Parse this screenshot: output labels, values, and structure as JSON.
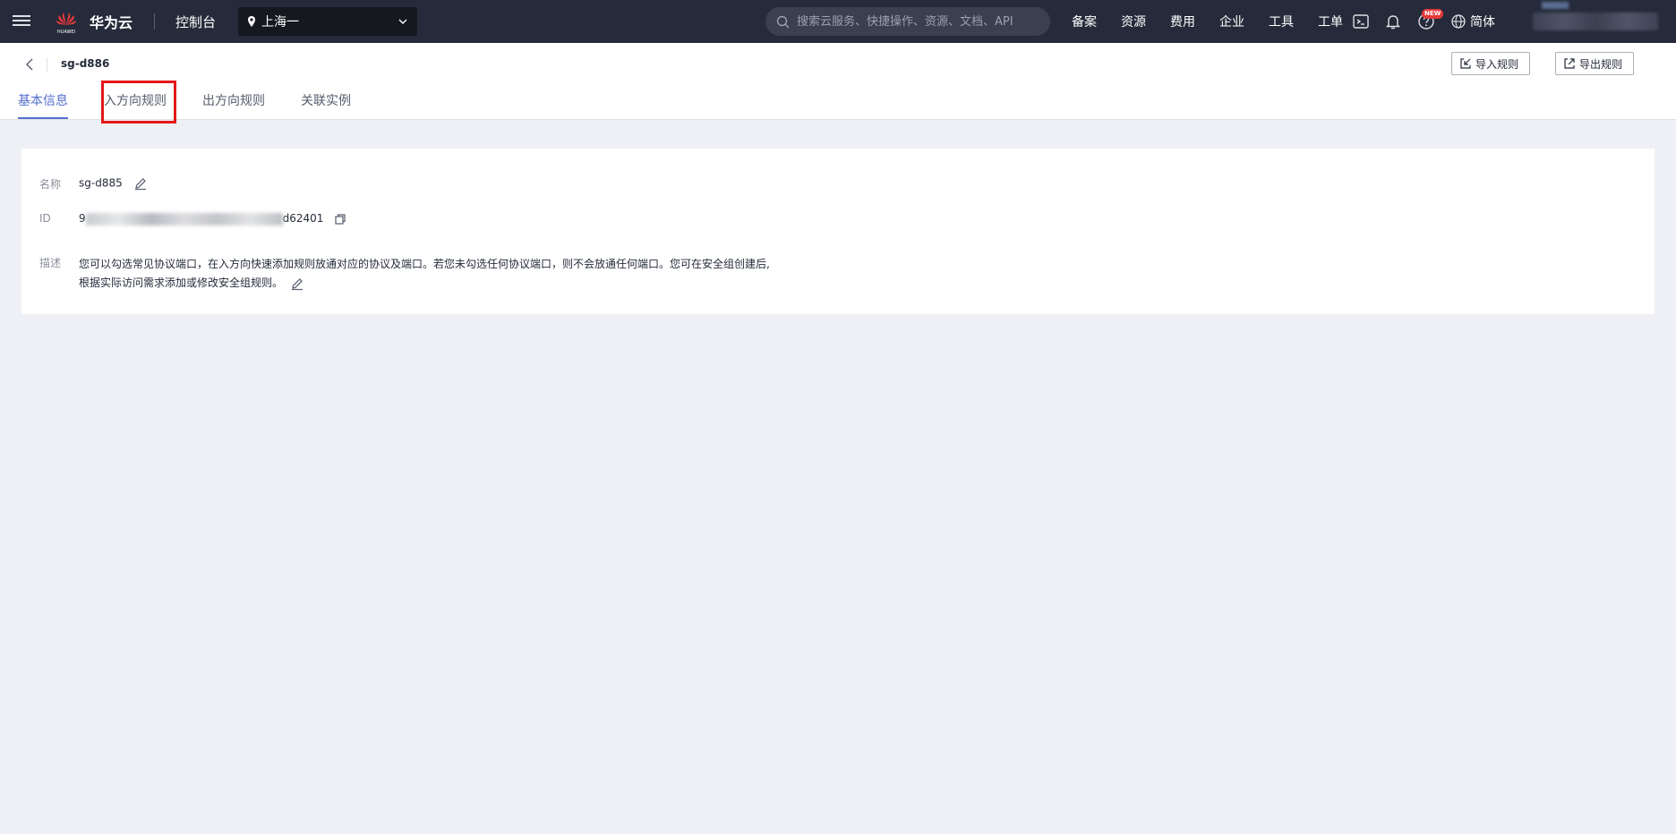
{
  "topbar": {
    "brand": "华为云",
    "logo_text": "HUAWEI",
    "console": "控制台",
    "region": "上海一",
    "search_placeholder": "搜索云服务、快捷操作、资源、文档、API",
    "nav_links": [
      "备案",
      "资源",
      "费用",
      "企业",
      "工具",
      "工单"
    ],
    "new_badge": "NEW",
    "language": "简体",
    "icons": [
      "menu-icon",
      "location-pin-icon",
      "chevron-down-icon",
      "search-icon",
      "terminal-icon",
      "bell-icon",
      "help-icon",
      "globe-icon"
    ]
  },
  "header": {
    "title": "sg-d886",
    "import_label": "导入规则",
    "export_label": "导出规则"
  },
  "tabs": [
    {
      "label": "基本信息",
      "active": true
    },
    {
      "label": "入方向规则",
      "active": false
    },
    {
      "label": "出方向规则",
      "active": false
    },
    {
      "label": "关联实例",
      "active": false
    }
  ],
  "info": {
    "name_label": "名称",
    "name_value": "sg-d885",
    "id_label": "ID",
    "id_prefix": "9",
    "id_suffix": "d62401",
    "desc_label": "描述",
    "desc_line1": "您可以勾选常见协议端口，在入方向快速添加规则放通对应的协议及端口。若您未勾选任何协议端口，则不会放通任何端口。您可在安全组创建后,",
    "desc_line2": "根据实际访问需求添加或修改安全组规则。"
  },
  "colors": {
    "topbar_bg": "#252b3a",
    "accent": "#526ecc",
    "highlight": "#e31818",
    "page_bg": "#eef0f5"
  }
}
